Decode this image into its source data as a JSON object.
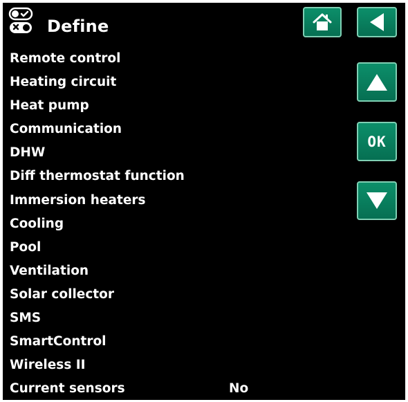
{
  "header": {
    "title": "Define",
    "icon": "toggle-switches-icon"
  },
  "buttons": {
    "home": {
      "icon": "home-icon"
    },
    "back": {
      "icon": "back-arrow-icon"
    },
    "up": {
      "icon": "arrow-up-icon"
    },
    "ok": {
      "label": "OK"
    },
    "down": {
      "icon": "arrow-down-icon"
    }
  },
  "menu": {
    "items": [
      {
        "label": "Remote control"
      },
      {
        "label": "Heating circuit"
      },
      {
        "label": "Heat pump"
      },
      {
        "label": "Communication"
      },
      {
        "label": "DHW"
      },
      {
        "label": "Diff thermostat function"
      },
      {
        "label": "Immersion heaters"
      },
      {
        "label": "Cooling"
      },
      {
        "label": "Pool"
      },
      {
        "label": "Ventilation"
      },
      {
        "label": "Solar collector"
      },
      {
        "label": "SMS"
      },
      {
        "label": "SmartControl"
      },
      {
        "label": "Wireless II"
      },
      {
        "label": "Current sensors",
        "value": "No"
      }
    ]
  },
  "colors": {
    "background": "#000000",
    "text": "#ffffff",
    "button": "#0a8060",
    "button_border": "#7fd0b4"
  }
}
